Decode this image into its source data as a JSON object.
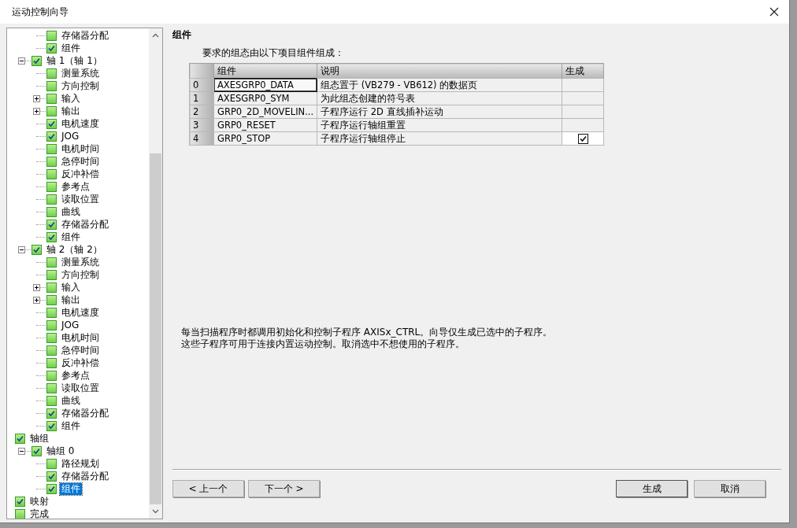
{
  "window": {
    "title": "运动控制向导"
  },
  "tree": [
    {
      "children": [
        {
          "children": [
            {
              "label": "存储器分配",
              "checked": false
            },
            {
              "label": "组件",
              "checked": true
            }
          ]
        },
        {
          "label": "轴 1（轴 1）",
          "checked": true,
          "expanded": true,
          "children": [
            {
              "label": "测量系统",
              "checked": false
            },
            {
              "label": "方向控制",
              "checked": false
            },
            {
              "label": "输入",
              "checked": false,
              "expanded": false
            },
            {
              "label": "输出",
              "checked": false,
              "expanded": false
            },
            {
              "label": "电机速度",
              "checked": true
            },
            {
              "label": "JOG",
              "checked": true
            },
            {
              "label": "电机时间",
              "checked": false
            },
            {
              "label": "急停时间",
              "checked": false
            },
            {
              "label": "反冲补偿",
              "checked": false
            },
            {
              "label": "参考点",
              "checked": false
            },
            {
              "label": "读取位置",
              "checked": false
            },
            {
              "label": "曲线",
              "checked": false
            },
            {
              "label": "存储器分配",
              "checked": true
            },
            {
              "label": "组件",
              "checked": true
            }
          ]
        },
        {
          "label": "轴 2（轴 2）",
          "checked": true,
          "expanded": true,
          "children": [
            {
              "label": "测量系统",
              "checked": false
            },
            {
              "label": "方向控制",
              "checked": false
            },
            {
              "label": "输入",
              "checked": false,
              "expanded": false
            },
            {
              "label": "输出",
              "checked": false,
              "expanded": false
            },
            {
              "label": "电机速度",
              "checked": false
            },
            {
              "label": "JOG",
              "checked": false
            },
            {
              "label": "电机时间",
              "checked": false
            },
            {
              "label": "急停时间",
              "checked": false
            },
            {
              "label": "反冲补偿",
              "checked": false
            },
            {
              "label": "参考点",
              "checked": false
            },
            {
              "label": "读取位置",
              "checked": false
            },
            {
              "label": "曲线",
              "checked": false
            },
            {
              "label": "存储器分配",
              "checked": true
            },
            {
              "label": "组件",
              "checked": true
            }
          ]
        }
      ]
    },
    {
      "label": "轴组",
      "checked": true,
      "children": [
        {
          "label": "轴组 0",
          "checked": true,
          "expanded": true,
          "children": [
            {
              "label": "路径规划",
              "checked": false,
              "selected": false
            },
            {
              "label": "存储器分配",
              "checked": true,
              "selected": false
            },
            {
              "label": "组件",
              "checked": true,
              "selected": true
            }
          ]
        }
      ]
    },
    {
      "label": "映射",
      "checked": true
    },
    {
      "label": "完成",
      "checked": false
    }
  ],
  "page": {
    "heading": "组件",
    "intro": "要求的组态由以下项目组件组成：",
    "table": {
      "columns": [
        "组件",
        "说明",
        "生成"
      ],
      "rows": [
        {
          "index": "0",
          "component": "AXESGRP0_DATA",
          "description": "组态置于 (VB279 - VB612) 的数据页",
          "editable": false,
          "selected": true
        },
        {
          "index": "1",
          "component": "AXESGRP0_SYM",
          "description": "为此组态创建的符号表",
          "editable": false,
          "selected": false
        },
        {
          "index": "2",
          "component": "GRP0_2D_MOVELIN...",
          "description": "子程序运行 2D 直线插补运动",
          "editable": false,
          "selected": false
        },
        {
          "index": "3",
          "component": "GRP0_RESET",
          "description": "子程序运行轴组重置",
          "editable": false,
          "selected": false
        },
        {
          "index": "4",
          "component": "GRP0_STOP",
          "description": "子程序运行轴组停止",
          "editable": true,
          "checked": true,
          "selected": false
        }
      ]
    },
    "notes": [
      "每当扫描程序时都调用初始化和控制子程序 AXISx_CTRL。向导仅生成已选中的子程序。",
      "这些子程序可用于连接内置运动控制。取消选中不想使用的子程序。"
    ]
  },
  "buttons": {
    "back": "< 上一个",
    "next": "下一个 >",
    "generate": "生成",
    "cancel": "取消"
  }
}
